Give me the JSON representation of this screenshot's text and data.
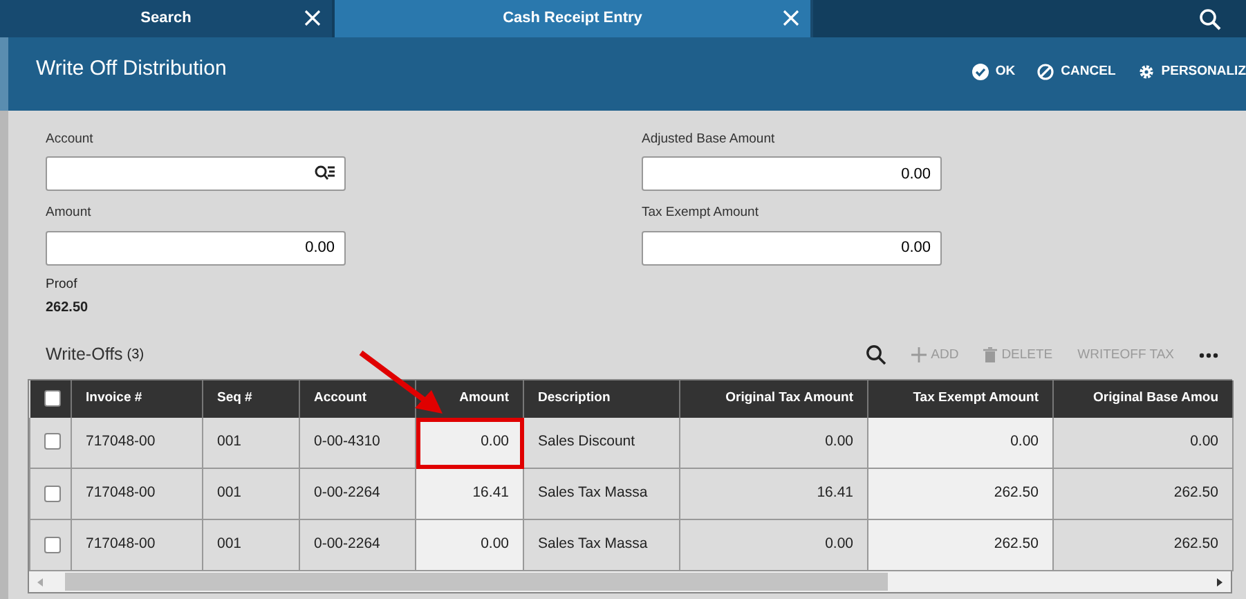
{
  "tabs": [
    {
      "label": "Search",
      "selected": false
    },
    {
      "label": "Cash Receipt Entry",
      "selected": true
    }
  ],
  "header": {
    "title": "Write Off Distribution",
    "actions": [
      {
        "kind": "ok",
        "label": "OK"
      },
      {
        "kind": "cancel",
        "label": "CANCEL"
      },
      {
        "kind": "personalize",
        "label": "PERSONALIZ"
      }
    ]
  },
  "form": {
    "fields": [
      {
        "label": "Account",
        "kind": "lookup"
      },
      {
        "label": "Adjusted Base Amount",
        "value": "0.00",
        "kind": "number"
      },
      {
        "label": "Amount",
        "value": "0.00",
        "kind": "number"
      },
      {
        "label": "Tax Exempt Amount",
        "value": "0.00",
        "kind": "number"
      }
    ],
    "proof": {
      "label": "Proof",
      "value": "262.50"
    }
  },
  "grid": {
    "title": "Write-Offs",
    "count": "(3)",
    "toolbar": [
      {
        "kind": "search",
        "disabled": false
      },
      {
        "kind": "add",
        "label": "ADD",
        "disabled": true
      },
      {
        "kind": "delete",
        "label": "DELETE",
        "disabled": true
      },
      {
        "kind": "text",
        "label": "WRITEOFF TAX",
        "disabled": true
      },
      {
        "kind": "more",
        "disabled": false
      }
    ],
    "header_checked": false,
    "columns": [
      "Invoice #",
      "Seq #",
      "Account",
      "Amount",
      "Description",
      "Original Tax Amount",
      "Tax Exempt Amount",
      "Original Base Amou"
    ],
    "rows": [
      {
        "checked": false,
        "highlighted": true,
        "cells": [
          "717048-00",
          "001",
          "0-00-4310",
          "0.00",
          "Sales Discount",
          "0.00",
          "0.00",
          "0.00"
        ]
      },
      {
        "checked": false,
        "highlighted": false,
        "cells": [
          "717048-00",
          "001",
          "0-00-2264",
          "16.41",
          "Sales Tax Massa",
          "16.41",
          "262.50",
          "262.50"
        ]
      },
      {
        "checked": false,
        "highlighted": false,
        "cells": [
          "717048-00",
          "001",
          "0-00-2264",
          "0.00",
          "Sales Tax Massa",
          "0.00",
          "262.50",
          "262.50"
        ]
      }
    ]
  }
}
